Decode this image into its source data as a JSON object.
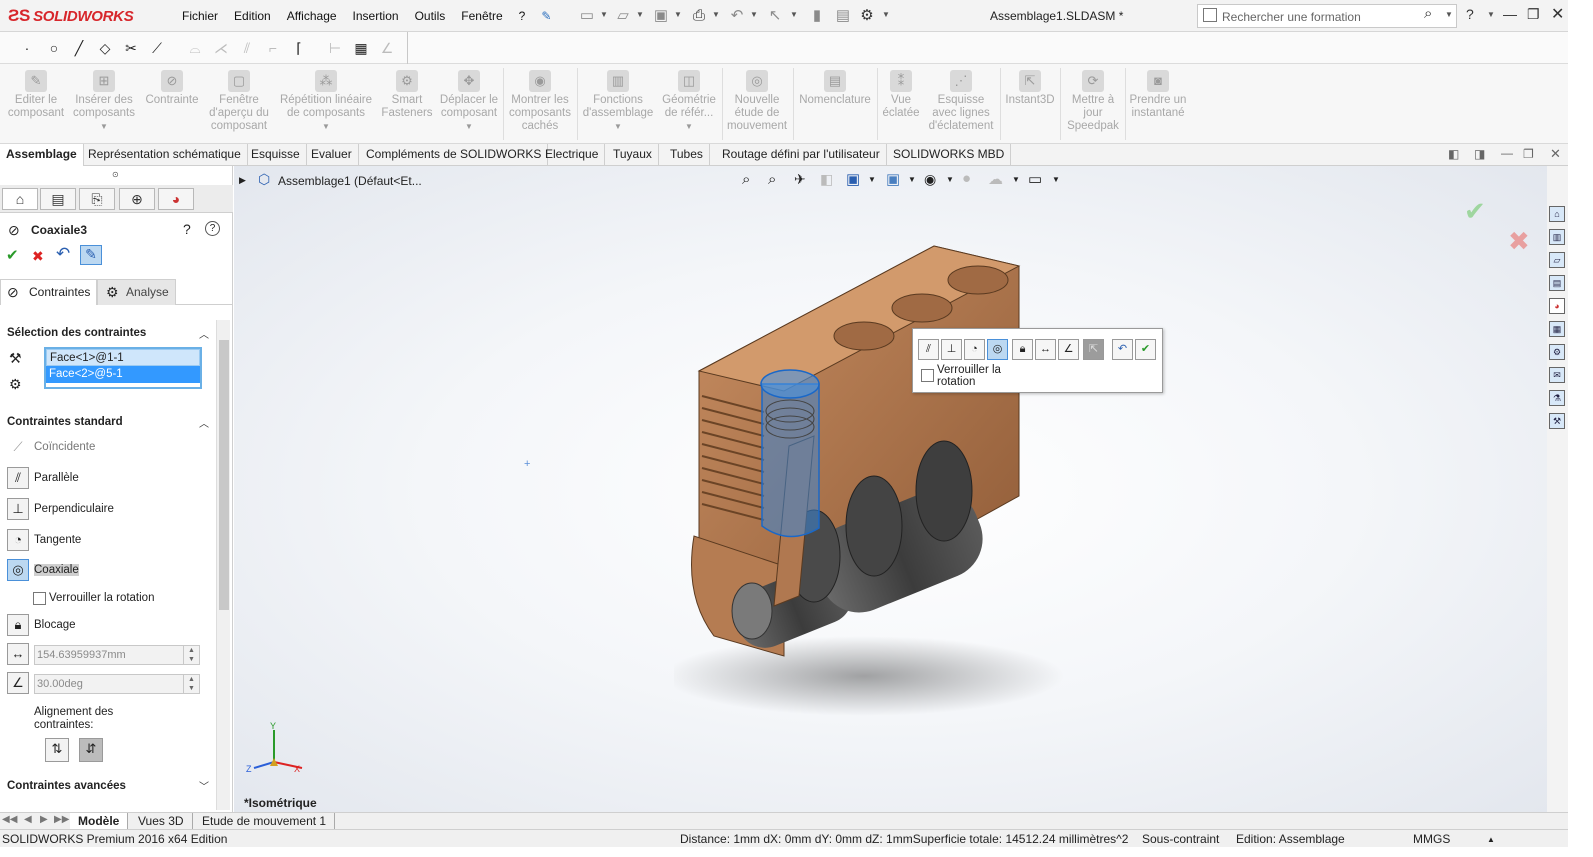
{
  "app": {
    "brand": "SOLIDWORKS",
    "document_title": "Assemblage1.SLDASM *"
  },
  "menu": [
    "Fichier",
    "Edition",
    "Affichage",
    "Insertion",
    "Outils",
    "Fenêtre",
    "?"
  ],
  "search": {
    "placeholder": "Rechercher une formation"
  },
  "command_manager": [
    {
      "label": "Editer le composant",
      "caret": false
    },
    {
      "label": "Insérer des composants",
      "caret": true
    },
    {
      "label": "Contrainte",
      "caret": false
    },
    {
      "label": "Fenêtre d'aperçu du composant",
      "caret": false
    },
    {
      "label": "Répétition linéaire de composants",
      "caret": true
    },
    {
      "label": "Smart Fasteners",
      "caret": false
    },
    {
      "label": "Déplacer le composant",
      "caret": true
    },
    {
      "label": "Montrer les composants cachés",
      "caret": false
    },
    {
      "label": "Fonctions d'assemblage",
      "caret": true
    },
    {
      "label": "Géométrie de référ...",
      "caret": true
    },
    {
      "label": "Nouvelle étude de mouvement",
      "caret": false
    },
    {
      "label": "Nomenclature",
      "caret": false
    },
    {
      "label": "Vue éclatée",
      "caret": false
    },
    {
      "label": "Esquisse avec lignes d'éclatement",
      "caret": false
    },
    {
      "label": "Instant3D",
      "caret": false
    },
    {
      "label": "Mettre à jour Speedpak",
      "caret": false
    },
    {
      "label": "Prendre un instantané",
      "caret": false
    }
  ],
  "tabs": [
    "Assemblage",
    "Représentation schématique",
    "Esquisse",
    "Evaluer",
    "Compléments de SOLIDWORKS",
    "Electrique",
    "Tuyaux",
    "Tubes",
    "Routage défini par l'utilisateur",
    "SOLIDWORKS MBD"
  ],
  "tree": {
    "root_label": "Assemblage1  (Défaut<Et..."
  },
  "property_manager": {
    "title": "Coaxiale3",
    "subtabs": [
      "Contraintes",
      "Analyse"
    ],
    "selection_header": "Sélection des contraintes",
    "selections": [
      "Face<1>@1-1",
      "Face<2>@5-1"
    ],
    "standard_header": "Contraintes standard",
    "mates": [
      {
        "label": "Coïncidente",
        "icon": "coincident-icon"
      },
      {
        "label": "Parallèle",
        "icon": "parallel-icon"
      },
      {
        "label": "Perpendiculaire",
        "icon": "perpendicular-icon"
      },
      {
        "label": "Tangente",
        "icon": "tangent-icon"
      },
      {
        "label": "Coaxiale",
        "icon": "concentric-icon"
      }
    ],
    "lock_rotation_label": "Verrouiller la rotation",
    "lock_label": "Blocage",
    "distance_value": "154.63959937mm",
    "angle_value": "30.00deg",
    "alignment_label": "Alignement des contraintes:",
    "advanced_header": "Contraintes avancées"
  },
  "popup": {
    "lock_rotation_label": "Verrouiller la rotation"
  },
  "view": {
    "name": "*Isométrique",
    "axis_x": "X",
    "axis_y": "Y",
    "axis_z": "Z"
  },
  "bottom_tabs": [
    "Modèle",
    "Vues 3D",
    "Etude de mouvement 1"
  ],
  "status": {
    "product": "SOLIDWORKS Premium 2016 x64 Edition",
    "measure": "Distance: 1mm   dX: 0mm   dY: 0mm   dZ: 1mmSuperficie totale: 14512.24 millimètres^2",
    "constraint": "Sous-contraint",
    "mode": "Edition: Assemblage",
    "units": "MMGS"
  },
  "colors": {
    "brand_red": "#d7262b",
    "selection_blue": "#3399ff",
    "copper": "#b07850",
    "shaft_dark": "#4a4a4a"
  }
}
